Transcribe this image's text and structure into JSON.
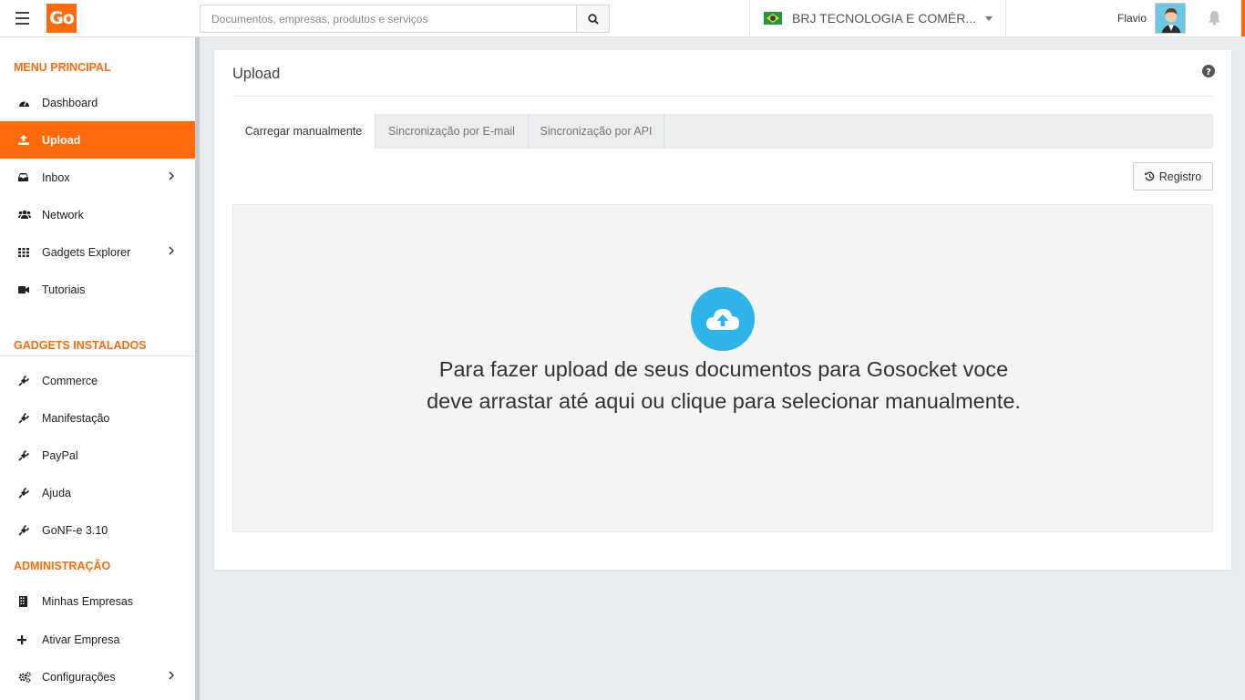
{
  "header": {
    "logo_text": "Go",
    "search_placeholder": "Documentos, empresas, produtos e serviços",
    "company_name": "BRJ TECNOLOGIA E COMÉR...",
    "username": "Flavio"
  },
  "sidebar": {
    "menu_principal_title": "MENU PRINCIPAL",
    "menu_principal": [
      {
        "label": "Dashboard",
        "icon": "dashboard-icon"
      },
      {
        "label": "Upload",
        "icon": "upload-icon",
        "active": true
      },
      {
        "label": "Inbox",
        "icon": "inbox-icon",
        "has_submenu": true
      },
      {
        "label": "Network",
        "icon": "users-icon"
      },
      {
        "label": "Gadgets Explorer",
        "icon": "grid-icon",
        "has_submenu": true
      },
      {
        "label": "Tutoriais",
        "icon": "video-camera-icon"
      }
    ],
    "gadgets_title": "GADGETS INSTALADOS",
    "gadgets": [
      {
        "label": "Commerce",
        "icon": "plug-icon"
      },
      {
        "label": "Manifestação",
        "icon": "plug-icon"
      },
      {
        "label": "PayPal",
        "icon": "plug-icon"
      },
      {
        "label": "Ajuda",
        "icon": "plug-icon"
      },
      {
        "label": "GoNF-e 3.10",
        "icon": "plug-icon"
      }
    ],
    "admin_title": "ADMINISTRAÇÃO",
    "admin": [
      {
        "label": "Minhas Empresas",
        "icon": "building-icon"
      },
      {
        "label": "Ativar Empresa",
        "icon": "plus-icon"
      },
      {
        "label": "Configurações",
        "icon": "cogs-icon",
        "has_submenu": true
      }
    ]
  },
  "main": {
    "title": "Upload",
    "tabs": [
      {
        "label": "Carregar manualmente",
        "active": true
      },
      {
        "label": "Sincronização por E-mail"
      },
      {
        "label": "Sincronização por API"
      }
    ],
    "registro_label": "Registro",
    "dropzone_line1": "Para fazer upload de seus documentos para Gosocket voce",
    "dropzone_line2": "deve arrastar até aqui ou clique para selecionar manualmente."
  },
  "colors": {
    "accent": "#ff6b0a",
    "upload_circle": "#2eb4e8"
  }
}
